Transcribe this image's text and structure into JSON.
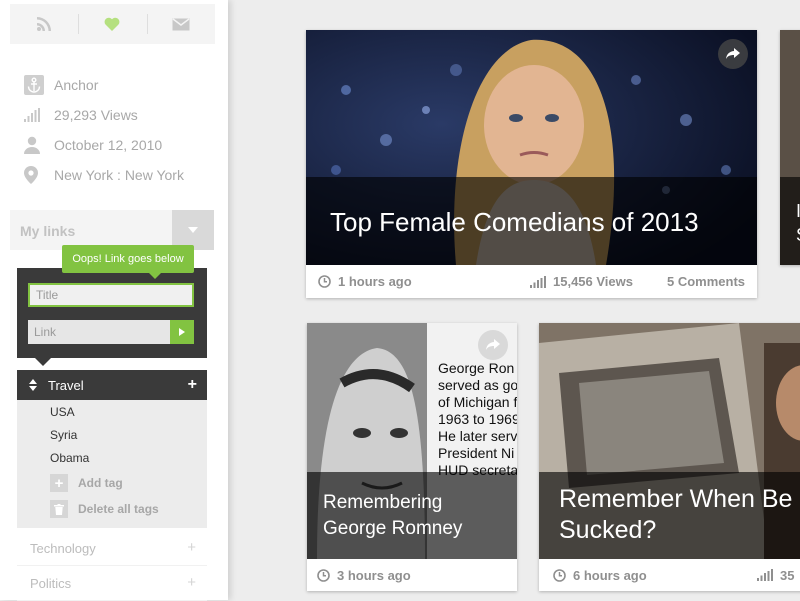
{
  "sidebar": {
    "top_icons": [
      "rss-icon",
      "heart-icon",
      "mail-icon"
    ],
    "meta": [
      {
        "icon": "anchor-icon",
        "text": "Anchor"
      },
      {
        "icon": "signal-icon",
        "text": "29,293 Views"
      },
      {
        "icon": "user-icon",
        "text": "October 12, 2010"
      },
      {
        "icon": "location-pin-icon",
        "text": "New York : New York"
      }
    ],
    "my_links_label": "My links",
    "tooltip": "Oops! Link goes below",
    "title_placeholder": "Title",
    "link_placeholder": "Link",
    "travel": {
      "label": "Travel",
      "plus": "+",
      "tags": [
        "USA",
        "Syria",
        "Obama"
      ],
      "add_tag": "Add tag",
      "delete_tags": "Delete all tags"
    },
    "categories": [
      {
        "label": "Technology",
        "plus": "+"
      },
      {
        "label": "Politics",
        "plus": "+"
      }
    ]
  },
  "cards": [
    {
      "title": "Top Female Comedians of 2013",
      "time": "1 hours ago",
      "views": "15,456 Views",
      "comments": "5 Comments"
    },
    {
      "title_line1": "Remembering",
      "title_line2": "George Romney",
      "time": "3 hours ago",
      "clip_text": [
        "George Ron",
        "served as go",
        "of Michigan f",
        "1963 to 1969",
        "He later serv",
        "President Ni",
        "HUD secreta"
      ]
    },
    {
      "title_line1": "Remember When Be",
      "title_line2": "Sucked?",
      "time": "6 hours ago",
      "views": "35"
    },
    {
      "partial_line1": "I",
      "partial_line2": "S"
    }
  ],
  "colors": {
    "accent_green": "#82c341",
    "dark_panel": "#3a3a3a",
    "heart": "#b5e07f"
  }
}
